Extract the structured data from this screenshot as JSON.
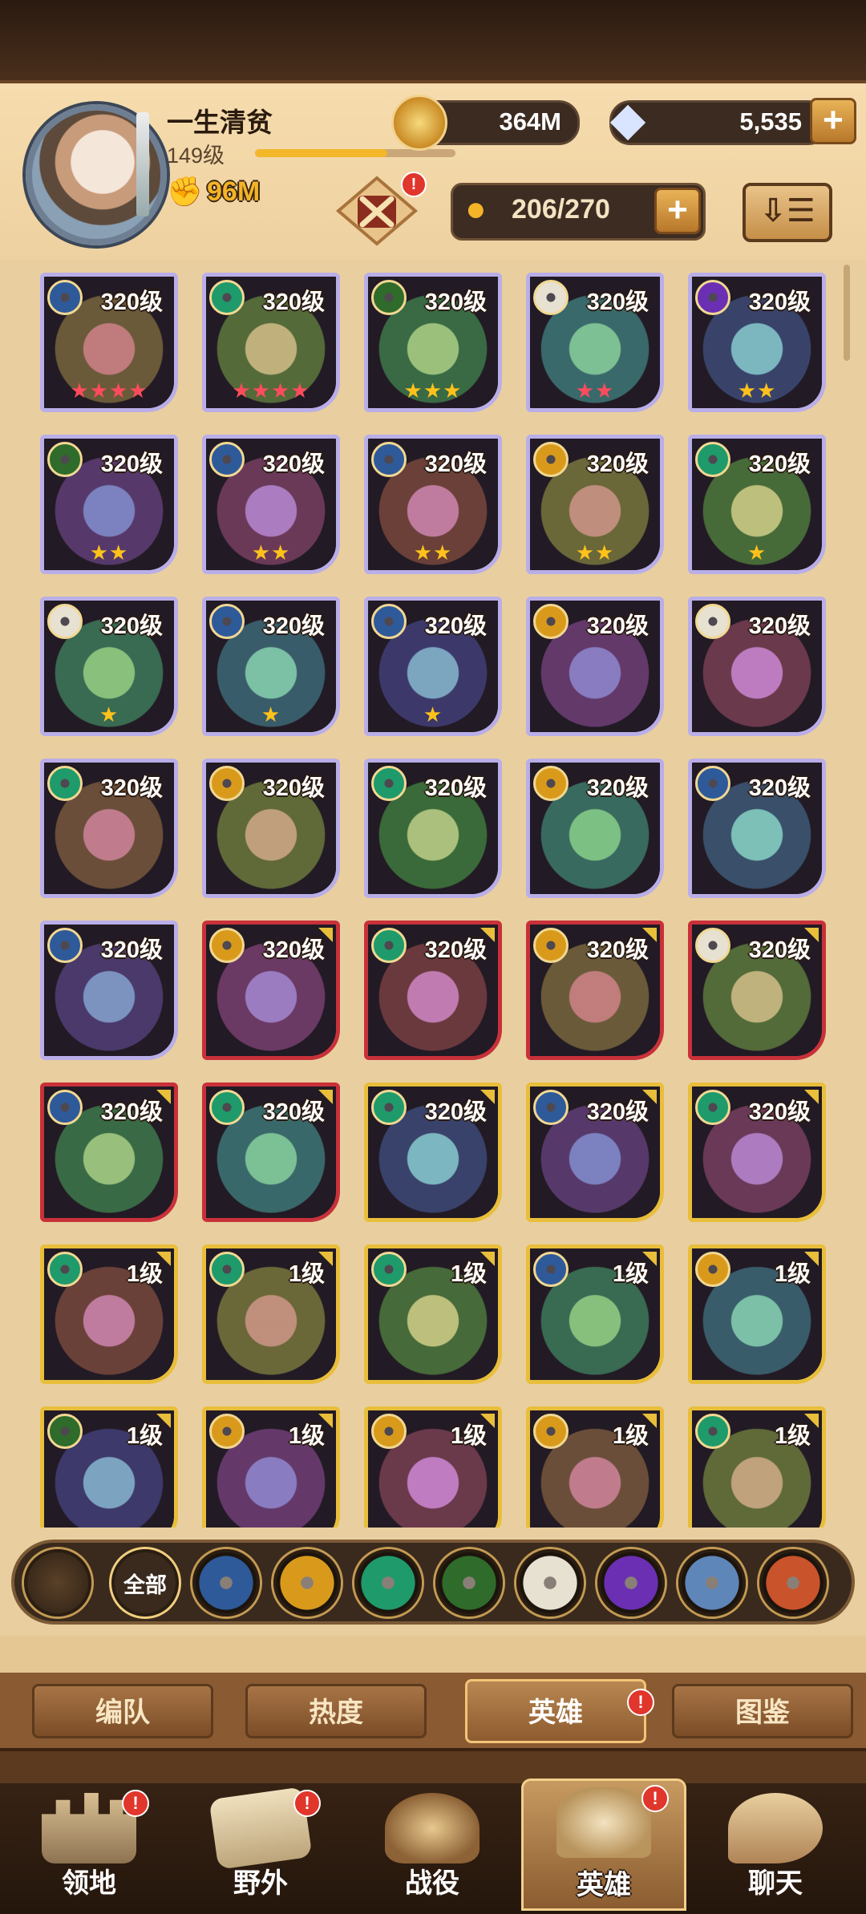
{
  "player": {
    "name": "一生清贫",
    "level": "149级",
    "xp_fraction": 0.66,
    "power": "96M"
  },
  "currency": {
    "gold": "364M",
    "gems": "5,535"
  },
  "hero_capacity": "206/270",
  "icons": {
    "power": "fist-icon",
    "gold": "gold-coin-icon",
    "gem": "diamond-icon",
    "capacity": "person-icon",
    "sort": "sort-icon",
    "crest": "crossed-swords-crest-icon"
  },
  "heroes": [
    {
      "level": "320级",
      "faction": "lightbearer",
      "stars": 4,
      "star_color": "red",
      "frame": "purple"
    },
    {
      "level": "320级",
      "faction": "wilder",
      "stars": 4,
      "star_color": "red",
      "frame": "purple"
    },
    {
      "level": "320级",
      "faction": "graveborn",
      "stars": 3,
      "star_color": "gold",
      "frame": "purple"
    },
    {
      "level": "320级",
      "faction": "celestial",
      "stars": 2,
      "star_color": "red",
      "frame": "purple"
    },
    {
      "level": "320级",
      "faction": "hypogean",
      "stars": 2,
      "star_color": "gold",
      "frame": "purple"
    },
    {
      "level": "320级",
      "faction": "graveborn",
      "stars": 2,
      "star_color": "gold",
      "frame": "purple"
    },
    {
      "level": "320级",
      "faction": "lightbearer",
      "stars": 2,
      "star_color": "gold",
      "frame": "purple"
    },
    {
      "level": "320级",
      "faction": "lightbearer",
      "stars": 2,
      "star_color": "gold",
      "frame": "purple"
    },
    {
      "level": "320级",
      "faction": "mauler",
      "stars": 2,
      "star_color": "gold",
      "frame": "purple"
    },
    {
      "level": "320级",
      "faction": "wilder",
      "stars": 1,
      "star_color": "gold",
      "frame": "purple"
    },
    {
      "level": "320级",
      "faction": "celestial",
      "stars": 1,
      "star_color": "gold",
      "frame": "purple"
    },
    {
      "level": "320级",
      "faction": "lightbearer",
      "stars": 1,
      "star_color": "gold",
      "frame": "purple"
    },
    {
      "level": "320级",
      "faction": "lightbearer",
      "stars": 1,
      "star_color": "gold",
      "frame": "purple"
    },
    {
      "level": "320级",
      "faction": "mauler",
      "stars": 0,
      "star_color": "gold",
      "frame": "purple"
    },
    {
      "level": "320级",
      "faction": "celestial",
      "stars": 0,
      "star_color": "gold",
      "frame": "purple"
    },
    {
      "level": "320级",
      "faction": "wilder",
      "stars": 0,
      "star_color": "gold",
      "frame": "purple"
    },
    {
      "level": "320级",
      "faction": "mauler",
      "stars": 0,
      "star_color": "gold",
      "frame": "purple"
    },
    {
      "level": "320级",
      "faction": "wilder",
      "stars": 0,
      "star_color": "gold",
      "frame": "purple"
    },
    {
      "level": "320级",
      "faction": "mauler",
      "stars": 0,
      "star_color": "gold",
      "frame": "purple"
    },
    {
      "level": "320级",
      "faction": "lightbearer",
      "stars": 0,
      "star_color": "gold",
      "frame": "purple"
    },
    {
      "level": "320级",
      "faction": "lightbearer",
      "stars": 0,
      "star_color": "gold",
      "frame": "purple"
    },
    {
      "level": "320级",
      "faction": "mauler",
      "stars": 0,
      "star_color": "gold",
      "frame": "red"
    },
    {
      "level": "320级",
      "faction": "wilder",
      "stars": 0,
      "star_color": "gold",
      "frame": "red"
    },
    {
      "level": "320级",
      "faction": "mauler",
      "stars": 0,
      "star_color": "gold",
      "frame": "red"
    },
    {
      "level": "320级",
      "faction": "celestial",
      "stars": 0,
      "star_color": "gold",
      "frame": "red"
    },
    {
      "level": "320级",
      "faction": "lightbearer",
      "stars": 0,
      "star_color": "gold",
      "frame": "red"
    },
    {
      "level": "320级",
      "faction": "wilder",
      "stars": 0,
      "star_color": "gold",
      "frame": "red"
    },
    {
      "level": "320级",
      "faction": "wilder",
      "stars": 0,
      "star_color": "gold",
      "frame": "gold"
    },
    {
      "level": "320级",
      "faction": "lightbearer",
      "stars": 0,
      "star_color": "gold",
      "frame": "gold"
    },
    {
      "level": "320级",
      "faction": "wilder",
      "stars": 0,
      "star_color": "gold",
      "frame": "gold"
    },
    {
      "level": "1级",
      "faction": "wilder",
      "stars": 0,
      "star_color": "gold",
      "frame": "gold"
    },
    {
      "level": "1级",
      "faction": "wilder",
      "stars": 0,
      "star_color": "gold",
      "frame": "gold"
    },
    {
      "level": "1级",
      "faction": "wilder",
      "stars": 0,
      "star_color": "gold",
      "frame": "gold"
    },
    {
      "level": "1级",
      "faction": "lightbearer",
      "stars": 0,
      "star_color": "gold",
      "frame": "gold"
    },
    {
      "level": "1级",
      "faction": "mauler",
      "stars": 0,
      "star_color": "gold",
      "frame": "gold"
    },
    {
      "level": "1级",
      "faction": "graveborn",
      "stars": 0,
      "star_color": "gold",
      "frame": "gold"
    },
    {
      "level": "1级",
      "faction": "mauler",
      "stars": 0,
      "star_color": "gold",
      "frame": "gold"
    },
    {
      "level": "1级",
      "faction": "mauler",
      "stars": 0,
      "star_color": "gold",
      "frame": "gold"
    },
    {
      "level": "1级",
      "faction": "mauler",
      "stars": 0,
      "star_color": "gold",
      "frame": "gold"
    },
    {
      "level": "1级",
      "faction": "wilder",
      "stars": 0,
      "star_color": "gold",
      "frame": "gold"
    }
  ],
  "filters": [
    {
      "name": "collapse",
      "label": ""
    },
    {
      "name": "all",
      "label": "全部"
    },
    {
      "name": "lightbearer",
      "label": ""
    },
    {
      "name": "mauler",
      "label": ""
    },
    {
      "name": "wilder",
      "label": ""
    },
    {
      "name": "graveborn",
      "label": ""
    },
    {
      "name": "celestial",
      "label": ""
    },
    {
      "name": "hypogean",
      "label": ""
    },
    {
      "name": "dimensional",
      "label": ""
    },
    {
      "name": "draconis",
      "label": ""
    }
  ],
  "faction_colors": {
    "lightbearer": "#2f5a9a",
    "mauler": "#d99a1c",
    "wilder": "#1f9a6b",
    "graveborn": "#2f6b2a",
    "celestial": "#e7e1d2",
    "hypogean": "#6b2fb3",
    "dimensional": "#5f86b8",
    "draconis": "#c9532a",
    "all": "#3a2a1d",
    "collapse": "#4a3522"
  },
  "subtabs": [
    {
      "label": "编队",
      "badge": ""
    },
    {
      "label": "热度",
      "badge": ""
    },
    {
      "label": "英雄",
      "badge": "!"
    },
    {
      "label": "图鉴",
      "badge": ""
    }
  ],
  "nav": [
    {
      "label": "领地",
      "icon": "castle-icon",
      "badge": "!"
    },
    {
      "label": "野外",
      "icon": "map-scroll-icon",
      "badge": "!"
    },
    {
      "label": "战役",
      "icon": "winged-sword-icon",
      "badge": ""
    },
    {
      "label": "英雄",
      "icon": "helmet-icon",
      "badge": "!"
    },
    {
      "label": "聊天",
      "icon": "chat-bubble-icon",
      "badge": ""
    }
  ],
  "badges": {
    "crest": "!"
  }
}
